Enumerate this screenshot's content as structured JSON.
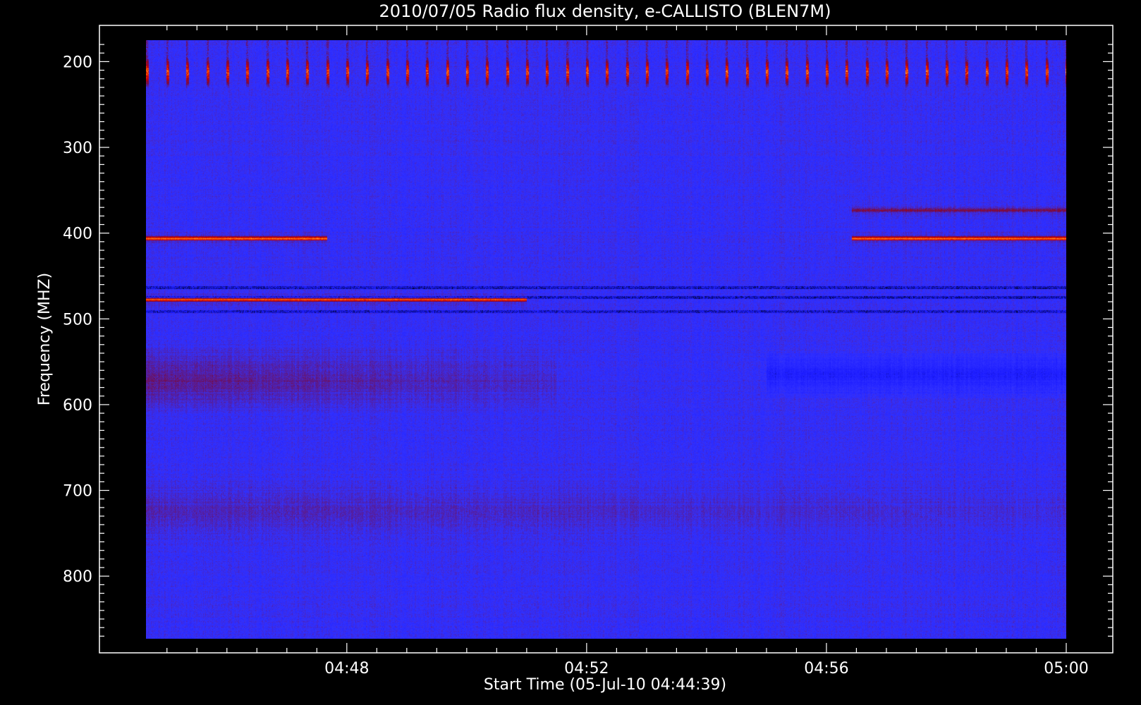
{
  "chart_data": {
    "type": "heatmap",
    "title": "2010/07/05  Radio flux density, e-CALLISTO (BLEN7M)",
    "xlabel": "Start Time (05-Jul-10 04:44:39)",
    "ylabel": "Frequency (MHZ)",
    "x_range": [
      "04:44:39",
      "05:00:00"
    ],
    "y_range_mhz": [
      175,
      873
    ],
    "y_inverted": true,
    "x_ticks": [
      {
        "time": "04:48",
        "label": "04:48"
      },
      {
        "time": "04:52",
        "label": "04:52"
      },
      {
        "time": "04:56",
        "label": "04:56"
      },
      {
        "time": "05:00",
        "label": "05:00"
      }
    ],
    "y_ticks": [
      200,
      300,
      400,
      500,
      600,
      700,
      800
    ],
    "colormap": [
      "#000000",
      "#1a1aff",
      "#3232ff",
      "#7a0a3a",
      "#d40000",
      "#ff6a00",
      "#ffe680"
    ],
    "background_level_color": "#2a2aff",
    "features": [
      {
        "kind": "emission_band",
        "f_mhz": 406,
        "t_start": "04:44:39",
        "t_end": "04:47:40",
        "intensity": "high"
      },
      {
        "kind": "emission_band",
        "f_mhz": 406,
        "t_start": "04:56:25",
        "t_end": "05:00:00",
        "intensity": "high"
      },
      {
        "kind": "emission_band",
        "f_mhz": 373,
        "t_start": "04:56:25",
        "t_end": "05:00:00",
        "intensity": "medium"
      },
      {
        "kind": "emission_band",
        "f_mhz": 477,
        "t_start": "04:44:39",
        "t_end": "04:51:00",
        "intensity": "high"
      },
      {
        "kind": "absorption_line",
        "f_mhz": 463,
        "t_start": "04:44:39",
        "t_end": "05:00:00"
      },
      {
        "kind": "absorption_line",
        "f_mhz": 475,
        "t_start": "04:44:39",
        "t_end": "05:00:00"
      },
      {
        "kind": "absorption_line",
        "f_mhz": 491,
        "t_start": "04:44:39",
        "t_end": "05:00:00"
      },
      {
        "kind": "diffuse_band",
        "f_mhz": 570,
        "t_start": "04:44:39",
        "t_end": "04:51:30",
        "intensity": "medium"
      },
      {
        "kind": "dark_band",
        "f_mhz": 565,
        "t_start": "04:55:00",
        "t_end": "05:00:00"
      },
      {
        "kind": "diffuse_band",
        "f_mhz": 725,
        "t_start": "04:44:39",
        "t_end": "05:00:00",
        "intensity": "low"
      },
      {
        "kind": "periodic_bursts",
        "f_mhz": 213,
        "t_start": "04:44:39",
        "t_end": "05:00:00",
        "period_s": 20,
        "intensity": "high"
      }
    ]
  }
}
